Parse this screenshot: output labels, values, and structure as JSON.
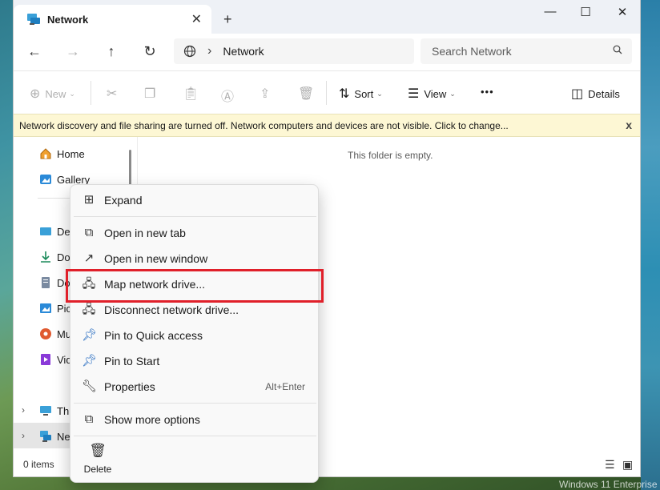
{
  "window": {
    "tab_title": "Network",
    "new_tab": "+",
    "tab_close": "✕",
    "controls": {
      "minimize": "—",
      "maximize": "☐",
      "close": "✕"
    }
  },
  "nav": {
    "back": "←",
    "forward": "→",
    "up": "↑",
    "refresh": "↻",
    "address_chevron": "›",
    "address_location": "Network",
    "search_placeholder": "Search Network"
  },
  "toolbar": {
    "new_label": "New",
    "sort_label": "Sort",
    "view_label": "View",
    "more_label": "•••",
    "details_label": "Details"
  },
  "infobar": {
    "message": "Network discovery and file sharing are turned off. Network computers and devices are not visible. Click to change...",
    "close": "x"
  },
  "navpane": {
    "items": [
      {
        "label": "Home",
        "icon": "home-icon"
      },
      {
        "label": "Gallery",
        "icon": "gallery-icon"
      },
      {
        "label": "Des",
        "icon": "desktop-icon"
      },
      {
        "label": "Do",
        "icon": "downloads-icon"
      },
      {
        "label": "Do",
        "icon": "documents-icon"
      },
      {
        "label": "Pic",
        "icon": "pictures-icon"
      },
      {
        "label": "Mu",
        "icon": "music-icon"
      },
      {
        "label": "Vid",
        "icon": "videos-icon"
      },
      {
        "label": "Thi",
        "icon": "this-pc-icon"
      },
      {
        "label": "Net",
        "icon": "network-icon"
      }
    ],
    "chevron": "›"
  },
  "content": {
    "empty_message": "This folder is empty."
  },
  "status": {
    "item_count": "0 items"
  },
  "context_menu": {
    "expand": "Expand",
    "open_new_tab": "Open in new tab",
    "open_new_window": "Open in new window",
    "map_drive": "Map network drive...",
    "disconnect_drive": "Disconnect network drive...",
    "pin_quick": "Pin to Quick access",
    "pin_start": "Pin to Start",
    "properties": "Properties",
    "properties_shortcut": "Alt+Enter",
    "show_more": "Show more options",
    "delete": "Delete"
  },
  "desktop": {
    "watermark": "Windows 11 Enterprise"
  },
  "colors": {
    "highlight": "#e0202a",
    "infobar": "#fdf7d4",
    "accent": "#2b6fc2"
  }
}
